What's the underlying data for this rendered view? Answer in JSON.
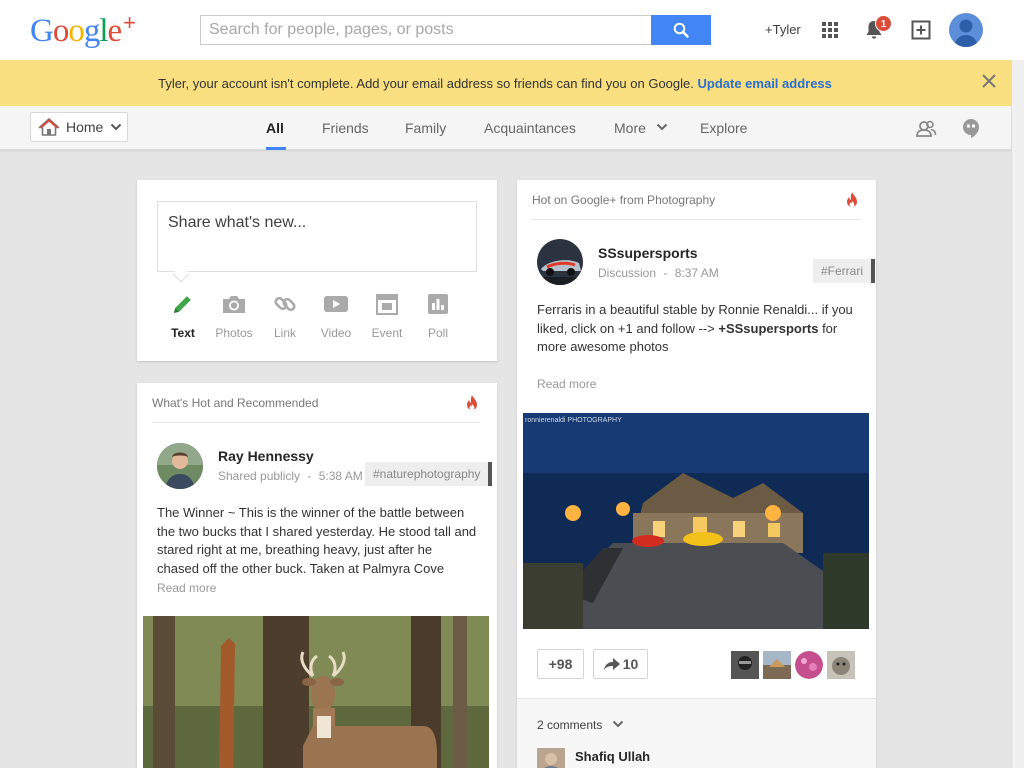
{
  "app": {
    "logo_text": "Google",
    "logo_plus": "+",
    "logo_colors": [
      "#4285f4",
      "#dd4b39",
      "#f4b400",
      "#4285f4",
      "#0f9d58",
      "#dd4b39"
    ]
  },
  "search": {
    "placeholder": "Search for people, pages, or posts",
    "button_icon": "search-icon"
  },
  "header": {
    "user_link": "+Tyler",
    "notification_count": "1",
    "icons": [
      "apps-icon",
      "bell-icon",
      "share-box-icon",
      "avatar-icon"
    ]
  },
  "notice": {
    "message": "Tyler, your account isn't complete. Add your email address so friends can find you on Google.",
    "link": "Update email address",
    "close_icon": "close-icon"
  },
  "nav": {
    "home_label": "Home",
    "tabs": [
      {
        "label": "All",
        "active": true
      },
      {
        "label": "Friends"
      },
      {
        "label": "Family"
      },
      {
        "label": "Acquaintances"
      },
      {
        "label": "More",
        "has_dropdown": true
      },
      {
        "label": "Explore"
      }
    ],
    "right_icons": [
      "circles-icon",
      "hangouts-icon"
    ]
  },
  "share_box": {
    "placeholder": "Share what's new...",
    "actions": [
      {
        "label": "Text",
        "icon": "pencil-icon",
        "active": true
      },
      {
        "label": "Photos",
        "icon": "camera-icon"
      },
      {
        "label": "Link",
        "icon": "link-icon"
      },
      {
        "label": "Video",
        "icon": "video-icon"
      },
      {
        "label": "Event",
        "icon": "event-icon"
      },
      {
        "label": "Poll",
        "icon": "poll-icon"
      }
    ]
  },
  "recommended_card": {
    "header": "What's Hot and Recommended",
    "post": {
      "author": "Ray Hennessy",
      "visibility": "Shared publicly",
      "separator": "-",
      "time": "5:38 AM",
      "tag": "#naturephotography",
      "body": "The Winner ~ This is the winner of the battle between the two bucks that I shared yesterday. He stood tall and stared right at me, breathing heavy, just after he chased off the other buck. Taken at Palmyra Cove",
      "read_more": "Read more"
    }
  },
  "hot_card": {
    "header": "Hot on Google+ from Photography",
    "post": {
      "author": "SSsupersports",
      "category": "Discussion",
      "separator": "-",
      "time": "8:37 AM",
      "tag": "#Ferrari",
      "body_prefix": "Ferraris in a beautiful stable by Ronnie Renaldi...  if you liked, click on +1 and follow --> ",
      "body_mention": "+SSsupersports",
      "body_suffix": " for more awesome photos",
      "read_more": "Read more",
      "photo_watermark": "ronnierenaldi PHOTOGRAPHY",
      "plus_ones": "+98",
      "shares": "10",
      "comments_label": "2 comments",
      "first_commenter": "Shafiq Ullah"
    }
  }
}
